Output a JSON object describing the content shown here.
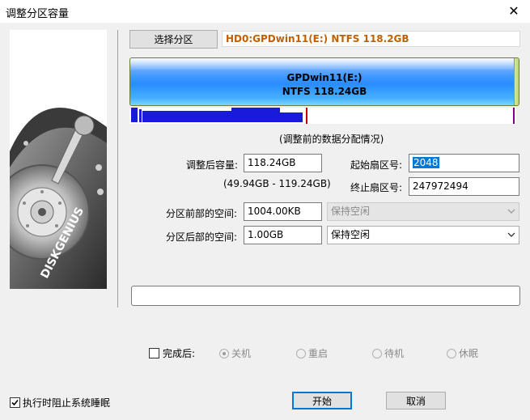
{
  "window": {
    "title": "调整分区容量",
    "close_glyph": "✕"
  },
  "brand": {
    "logo_text": "DISKGENIUS"
  },
  "toolbar": {
    "select_partition_label": "选择分区",
    "disk_info": "HD0:GPDwin11(E:) NTFS 118.2GB"
  },
  "partition_bar": {
    "name": "GPDwin11(E:)",
    "fs_size": "NTFS 118.24GB"
  },
  "section_caption": "(调整前的数据分配情况)",
  "resize": {
    "new_size_label": "调整后容量:",
    "new_size_value": "118.24GB",
    "range_text": "(49.94GB - 119.24GB)",
    "start_sector_label": "起始扇区号:",
    "start_sector_value": "2048",
    "end_sector_label": "终止扇区号:",
    "end_sector_value": "247972494",
    "before_space_label": "分区前部的空间:",
    "before_space_value": "1004.00KB",
    "before_space_action": "保持空闲",
    "after_space_label": "分区后部的空间:",
    "after_space_value": "1.00GB",
    "after_space_action": "保持空闲"
  },
  "status_field": {
    "value": ""
  },
  "after_completion": {
    "label": "完成后:",
    "options": [
      "关机",
      "重启",
      "待机",
      "休眠"
    ],
    "selected": 0
  },
  "footer": {
    "prevent_sleep_label": "执行时阻止系统睡眠",
    "prevent_sleep_checked": true,
    "start_label": "开始",
    "cancel_label": "取消"
  },
  "colors": {
    "accent": "#0078d7",
    "disk_info_text": "#c06000",
    "partition_blue": "#2a8cff"
  }
}
